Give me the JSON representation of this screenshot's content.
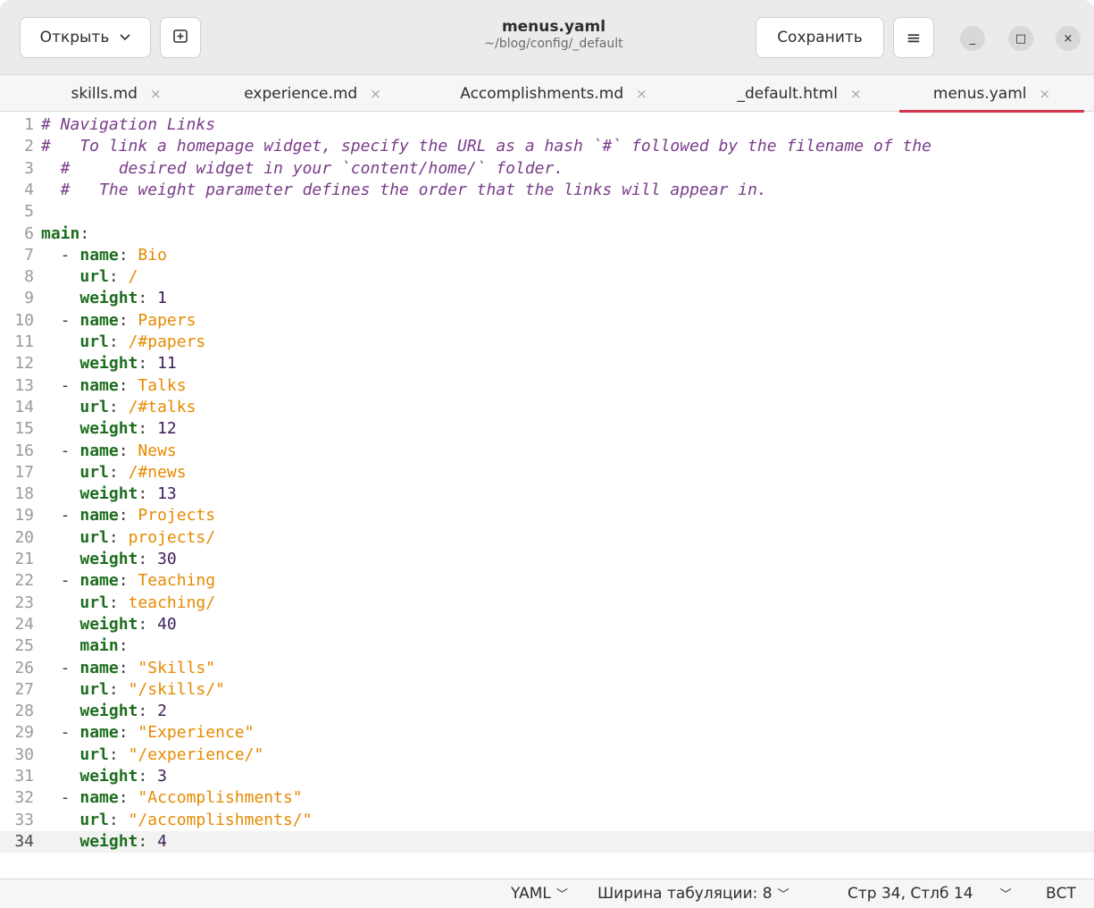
{
  "header": {
    "open_label": "Открыть",
    "newtab_icon": "+",
    "title": "menus.yaml",
    "subtitle": "~/blog/config/_default",
    "save_label": "Сохранить",
    "menu_icon": "≡",
    "minimize_icon": "_",
    "maximize_icon": "□",
    "close_icon": "×"
  },
  "tabs": [
    {
      "label": "skills.md",
      "close": "×"
    },
    {
      "label": "experience.md",
      "close": "×"
    },
    {
      "label": "Accomplishments.md",
      "close": "×"
    },
    {
      "label": "_default.html",
      "close": "×"
    },
    {
      "label": "menus.yaml",
      "close": "×"
    }
  ],
  "lines": [
    {
      "n": "1",
      "segs": [
        [
          "comment",
          "# Navigation Links"
        ]
      ]
    },
    {
      "n": "2",
      "segs": [
        [
          "comment",
          "#   To link a homepage widget, specify the URL as a hash `#` followed by the filename of the"
        ]
      ]
    },
    {
      "n": "3",
      "segs": [
        [
          "comment",
          "  #     desired widget in your `content/home/` folder."
        ]
      ]
    },
    {
      "n": "4",
      "segs": [
        [
          "comment",
          "  #   The weight parameter defines the order that the links will appear in."
        ]
      ]
    },
    {
      "n": "5",
      "segs": []
    },
    {
      "n": "6",
      "segs": [
        [
          "key",
          "main"
        ],
        [
          "plain",
          ":"
        ]
      ]
    },
    {
      "n": "7",
      "segs": [
        [
          "plain",
          "  - "
        ],
        [
          "key",
          "name"
        ],
        [
          "plain",
          ": "
        ],
        [
          "str",
          "Bio"
        ]
      ]
    },
    {
      "n": "8",
      "segs": [
        [
          "plain",
          "    "
        ],
        [
          "key",
          "url"
        ],
        [
          "plain",
          ": "
        ],
        [
          "str",
          "/"
        ]
      ]
    },
    {
      "n": "9",
      "segs": [
        [
          "plain",
          "    "
        ],
        [
          "key",
          "weight"
        ],
        [
          "plain",
          ": "
        ],
        [
          "num",
          "1"
        ]
      ]
    },
    {
      "n": "10",
      "segs": [
        [
          "plain",
          "  - "
        ],
        [
          "key",
          "name"
        ],
        [
          "plain",
          ": "
        ],
        [
          "str",
          "Papers"
        ]
      ]
    },
    {
      "n": "11",
      "segs": [
        [
          "plain",
          "    "
        ],
        [
          "key",
          "url"
        ],
        [
          "plain",
          ": "
        ],
        [
          "str",
          "/#papers"
        ]
      ]
    },
    {
      "n": "12",
      "segs": [
        [
          "plain",
          "    "
        ],
        [
          "key",
          "weight"
        ],
        [
          "plain",
          ": "
        ],
        [
          "num",
          "11"
        ]
      ]
    },
    {
      "n": "13",
      "segs": [
        [
          "plain",
          "  - "
        ],
        [
          "key",
          "name"
        ],
        [
          "plain",
          ": "
        ],
        [
          "str",
          "Talks"
        ]
      ]
    },
    {
      "n": "14",
      "segs": [
        [
          "plain",
          "    "
        ],
        [
          "key",
          "url"
        ],
        [
          "plain",
          ": "
        ],
        [
          "str",
          "/#talks"
        ]
      ]
    },
    {
      "n": "15",
      "segs": [
        [
          "plain",
          "    "
        ],
        [
          "key",
          "weight"
        ],
        [
          "plain",
          ": "
        ],
        [
          "num",
          "12"
        ]
      ]
    },
    {
      "n": "16",
      "segs": [
        [
          "plain",
          "  - "
        ],
        [
          "key",
          "name"
        ],
        [
          "plain",
          ": "
        ],
        [
          "str",
          "News"
        ]
      ]
    },
    {
      "n": "17",
      "segs": [
        [
          "plain",
          "    "
        ],
        [
          "key",
          "url"
        ],
        [
          "plain",
          ": "
        ],
        [
          "str",
          "/#news"
        ]
      ]
    },
    {
      "n": "18",
      "segs": [
        [
          "plain",
          "    "
        ],
        [
          "key",
          "weight"
        ],
        [
          "plain",
          ": "
        ],
        [
          "num",
          "13"
        ]
      ]
    },
    {
      "n": "19",
      "segs": [
        [
          "plain",
          "  - "
        ],
        [
          "key",
          "name"
        ],
        [
          "plain",
          ": "
        ],
        [
          "str",
          "Projects"
        ]
      ]
    },
    {
      "n": "20",
      "segs": [
        [
          "plain",
          "    "
        ],
        [
          "key",
          "url"
        ],
        [
          "plain",
          ": "
        ],
        [
          "str",
          "projects/"
        ]
      ]
    },
    {
      "n": "21",
      "segs": [
        [
          "plain",
          "    "
        ],
        [
          "key",
          "weight"
        ],
        [
          "plain",
          ": "
        ],
        [
          "num",
          "30"
        ]
      ]
    },
    {
      "n": "22",
      "segs": [
        [
          "plain",
          "  - "
        ],
        [
          "key",
          "name"
        ],
        [
          "plain",
          ": "
        ],
        [
          "str",
          "Teaching"
        ]
      ]
    },
    {
      "n": "23",
      "segs": [
        [
          "plain",
          "    "
        ],
        [
          "key",
          "url"
        ],
        [
          "plain",
          ": "
        ],
        [
          "str",
          "teaching/"
        ]
      ]
    },
    {
      "n": "24",
      "segs": [
        [
          "plain",
          "    "
        ],
        [
          "key",
          "weight"
        ],
        [
          "plain",
          ": "
        ],
        [
          "num",
          "40"
        ]
      ]
    },
    {
      "n": "25",
      "segs": [
        [
          "plain",
          "    "
        ],
        [
          "key",
          "main"
        ],
        [
          "plain",
          ":"
        ]
      ]
    },
    {
      "n": "26",
      "segs": [
        [
          "plain",
          "  - "
        ],
        [
          "key",
          "name"
        ],
        [
          "plain",
          ": "
        ],
        [
          "str",
          "\"Skills\""
        ]
      ]
    },
    {
      "n": "27",
      "segs": [
        [
          "plain",
          "    "
        ],
        [
          "key",
          "url"
        ],
        [
          "plain",
          ": "
        ],
        [
          "str",
          "\"/skills/\""
        ]
      ]
    },
    {
      "n": "28",
      "segs": [
        [
          "plain",
          "    "
        ],
        [
          "key",
          "weight"
        ],
        [
          "plain",
          ": "
        ],
        [
          "num",
          "2"
        ]
      ]
    },
    {
      "n": "29",
      "segs": [
        [
          "plain",
          "  - "
        ],
        [
          "key",
          "name"
        ],
        [
          "plain",
          ": "
        ],
        [
          "str",
          "\"Experience\""
        ]
      ]
    },
    {
      "n": "30",
      "segs": [
        [
          "plain",
          "    "
        ],
        [
          "key",
          "url"
        ],
        [
          "plain",
          ": "
        ],
        [
          "str",
          "\"/experience/\""
        ]
      ]
    },
    {
      "n": "31",
      "segs": [
        [
          "plain",
          "    "
        ],
        [
          "key",
          "weight"
        ],
        [
          "plain",
          ": "
        ],
        [
          "num",
          "3"
        ]
      ]
    },
    {
      "n": "32",
      "segs": [
        [
          "plain",
          "  - "
        ],
        [
          "key",
          "name"
        ],
        [
          "plain",
          ": "
        ],
        [
          "str",
          "\"Accomplishments\""
        ]
      ]
    },
    {
      "n": "33",
      "segs": [
        [
          "plain",
          "    "
        ],
        [
          "key",
          "url"
        ],
        [
          "plain",
          ": "
        ],
        [
          "str",
          "\"/accomplishments/\""
        ]
      ]
    },
    {
      "n": "34",
      "segs": [
        [
          "plain",
          "    "
        ],
        [
          "key",
          "weight"
        ],
        [
          "plain",
          ": "
        ],
        [
          "num",
          "4"
        ]
      ],
      "current": true
    }
  ],
  "status": {
    "language": "YAML",
    "tab_width": "Ширина табуляции: 8",
    "position": "Стр 34, Стлб 14",
    "mode": "ВСТ",
    "chevron": "﹀"
  }
}
